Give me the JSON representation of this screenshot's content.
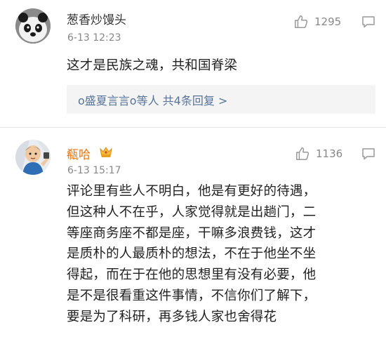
{
  "comments": [
    {
      "user": "葱香炒馒头",
      "time": "6-13 12:23",
      "likes": "1295",
      "text": [
        "这才是民族之魂，共和国脊梁"
      ],
      "reply_summary": "o盛夏言言o等人  共4条回复 >",
      "avatar_icon": "avatar-panda-icon"
    },
    {
      "user": "瓻哈",
      "time": "6-13 15:17",
      "likes": "1136",
      "name_color": "#e8740c",
      "badge_icon": "vip-crown-icon",
      "avatar_icon": "avatar-cartoon-icon",
      "text": [
        "评论里有些人不明白，他是有更好的待遇，",
        "但这种人不在乎，人家觉得就是出趟门，二",
        "等座商务座不都是座，干嘛多浪费钱，这才",
        "是质朴的人最质朴的想法，不在于他坐不坐",
        "得起，而在于在他的思想里有没有必要，他",
        "是不是很看重这件事情，不信你们了解下，",
        "要是为了科研，再多钱人家也舍得花"
      ]
    }
  ],
  "icons": {
    "like": "thumbs-up-icon",
    "reply": "comment-bubble-icon"
  }
}
